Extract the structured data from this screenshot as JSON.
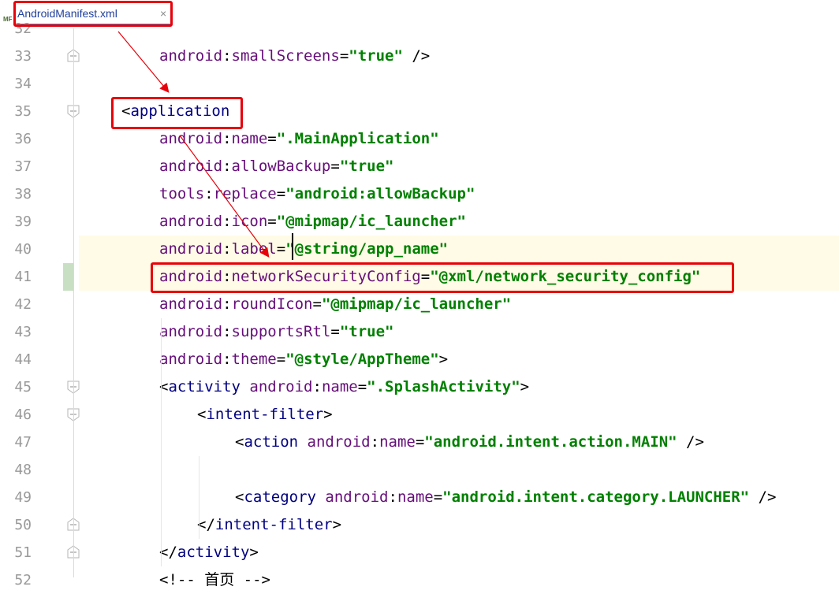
{
  "tab": {
    "filename": "AndroidManifest.xml",
    "close": "×",
    "icon_text": "MF"
  },
  "lines": [
    {
      "no": "32",
      "indent": 2,
      "tokens": []
    },
    {
      "no": "33",
      "indent": 2,
      "tokens": [
        [
          "attr-ns",
          "android"
        ],
        [
          "punct",
          ":"
        ],
        [
          "attr-name",
          "smallScreens"
        ],
        [
          "punct",
          "="
        ],
        [
          "value",
          "\"true\""
        ],
        [
          "punct",
          " />"
        ]
      ]
    },
    {
      "no": "34",
      "indent": 0,
      "tokens": []
    },
    {
      "no": "35",
      "indent": 1,
      "tokens": [
        [
          "punct",
          "<"
        ],
        [
          "tag",
          "application"
        ]
      ]
    },
    {
      "no": "36",
      "indent": 2,
      "tokens": [
        [
          "attr-ns",
          "android"
        ],
        [
          "punct",
          ":"
        ],
        [
          "attr-name",
          "name"
        ],
        [
          "punct",
          "="
        ],
        [
          "value",
          "\".MainApplication\""
        ]
      ]
    },
    {
      "no": "37",
      "indent": 2,
      "tokens": [
        [
          "attr-ns",
          "android"
        ],
        [
          "punct",
          ":"
        ],
        [
          "attr-name",
          "allowBackup"
        ],
        [
          "punct",
          "="
        ],
        [
          "value",
          "\"true\""
        ]
      ]
    },
    {
      "no": "38",
      "indent": 2,
      "tokens": [
        [
          "attr-ns",
          "tools"
        ],
        [
          "punct",
          ":"
        ],
        [
          "attr-name",
          "replace"
        ],
        [
          "punct",
          "="
        ],
        [
          "value",
          "\"android:allowBackup\""
        ]
      ]
    },
    {
      "no": "39",
      "indent": 2,
      "tokens": [
        [
          "attr-ns",
          "android"
        ],
        [
          "punct",
          ":"
        ],
        [
          "attr-name",
          "icon"
        ],
        [
          "punct",
          "="
        ],
        [
          "value",
          "\"@mipmap/ic_launcher\""
        ]
      ]
    },
    {
      "no": "40",
      "indent": 2,
      "tokens": [
        [
          "attr-ns",
          "android"
        ],
        [
          "punct",
          ":"
        ],
        [
          "attr-name",
          "label"
        ],
        [
          "punct",
          "="
        ],
        [
          "value",
          "\"@string/app_name\""
        ]
      ]
    },
    {
      "no": "41",
      "indent": 2,
      "tokens": [
        [
          "attr-ns",
          "android"
        ],
        [
          "punct",
          ":"
        ],
        [
          "attr-name",
          "networkSecurityConfig"
        ],
        [
          "punct",
          "="
        ],
        [
          "value",
          "\"@xml/network_security_config\""
        ]
      ]
    },
    {
      "no": "42",
      "indent": 2,
      "tokens": [
        [
          "attr-ns",
          "android"
        ],
        [
          "punct",
          ":"
        ],
        [
          "attr-name",
          "roundIcon"
        ],
        [
          "punct",
          "="
        ],
        [
          "value",
          "\"@mipmap/ic_launcher\""
        ]
      ]
    },
    {
      "no": "43",
      "indent": 2,
      "tokens": [
        [
          "attr-ns",
          "android"
        ],
        [
          "punct",
          ":"
        ],
        [
          "attr-name",
          "supportsRtl"
        ],
        [
          "punct",
          "="
        ],
        [
          "value",
          "\"true\""
        ]
      ]
    },
    {
      "no": "44",
      "indent": 2,
      "tokens": [
        [
          "attr-ns",
          "android"
        ],
        [
          "punct",
          ":"
        ],
        [
          "attr-name",
          "theme"
        ],
        [
          "punct",
          "="
        ],
        [
          "value",
          "\"@style/AppTheme\""
        ],
        [
          "punct",
          ">"
        ]
      ]
    },
    {
      "no": "45",
      "indent": 2,
      "tokens": [
        [
          "punct",
          "<"
        ],
        [
          "tag",
          "activity"
        ],
        [
          "punct",
          " "
        ],
        [
          "attr-ns",
          "android"
        ],
        [
          "punct",
          ":"
        ],
        [
          "attr-name",
          "name"
        ],
        [
          "punct",
          "="
        ],
        [
          "value",
          "\".SplashActivity\""
        ],
        [
          "punct",
          ">"
        ]
      ]
    },
    {
      "no": "46",
      "indent": 3,
      "tokens": [
        [
          "punct",
          "<"
        ],
        [
          "tag",
          "intent-filter"
        ],
        [
          "punct",
          ">"
        ]
      ]
    },
    {
      "no": "47",
      "indent": 4,
      "tokens": [
        [
          "punct",
          "<"
        ],
        [
          "tag",
          "action"
        ],
        [
          "punct",
          " "
        ],
        [
          "attr-ns",
          "android"
        ],
        [
          "punct",
          ":"
        ],
        [
          "attr-name",
          "name"
        ],
        [
          "punct",
          "="
        ],
        [
          "value",
          "\"android.intent.action.MAIN\""
        ],
        [
          "punct",
          " />"
        ]
      ]
    },
    {
      "no": "48",
      "indent": 0,
      "tokens": []
    },
    {
      "no": "49",
      "indent": 4,
      "tokens": [
        [
          "punct",
          "<"
        ],
        [
          "tag",
          "category"
        ],
        [
          "punct",
          " "
        ],
        [
          "attr-ns",
          "android"
        ],
        [
          "punct",
          ":"
        ],
        [
          "attr-name",
          "name"
        ],
        [
          "punct",
          "="
        ],
        [
          "value",
          "\"android.intent.category.LAUNCHER\""
        ],
        [
          "punct",
          " />"
        ]
      ]
    },
    {
      "no": "50",
      "indent": 3,
      "tokens": [
        [
          "punct",
          "</"
        ],
        [
          "tag",
          "intent-filter"
        ],
        [
          "punct",
          ">"
        ]
      ]
    },
    {
      "no": "51",
      "indent": 2,
      "tokens": [
        [
          "punct",
          "</"
        ],
        [
          "tag",
          "activity"
        ],
        [
          "punct",
          ">"
        ]
      ]
    },
    {
      "no": "52",
      "indent": 2,
      "tokens": [
        [
          "punct",
          "<!-- 首页 -->"
        ]
      ]
    }
  ],
  "colors": {
    "annotation": "#e8000a",
    "current_line": "#fffbe6",
    "tag": "#000080",
    "attr": "#660e7a",
    "value": "#008000"
  }
}
